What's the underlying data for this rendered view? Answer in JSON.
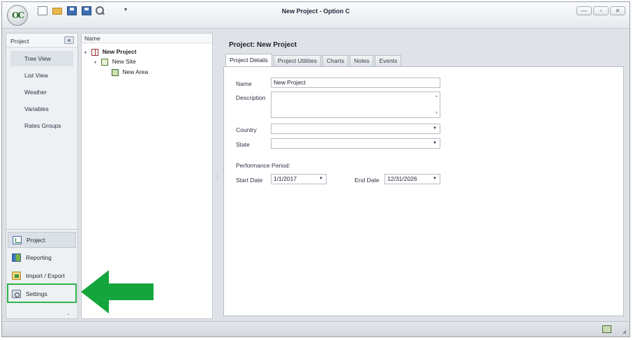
{
  "window": {
    "title": "New Project - Option C",
    "logo_text": "OC",
    "quick_access_more": "▾",
    "buttons": {
      "minimize": "—",
      "restore": "▫",
      "close": "✕"
    }
  },
  "nav": {
    "header": "Project",
    "collapse": "«",
    "items": [
      {
        "label": "Tree View",
        "active": true
      },
      {
        "label": "List View"
      },
      {
        "label": "Weather"
      },
      {
        "label": "Variables"
      },
      {
        "label": "Rates Groups"
      }
    ],
    "groups": [
      {
        "label": "Project",
        "icon": "project-icon",
        "active": true
      },
      {
        "label": "Reporting",
        "icon": "reporting-icon"
      },
      {
        "label": "Import / Export",
        "icon": "import-export-icon"
      },
      {
        "label": "Settings",
        "icon": "settings-icon"
      }
    ],
    "more_chevron": "⌄"
  },
  "tree": {
    "header": "Name",
    "nodes": [
      {
        "label": "New Project",
        "icon": "project-book-icon",
        "toggle": "▾"
      },
      {
        "label": "New Site",
        "icon": "site-icon",
        "toggle": "▾"
      },
      {
        "label": "New Area",
        "icon": "area-icon"
      }
    ]
  },
  "main": {
    "title": "Project: New Project",
    "tabs": [
      {
        "label": "Project Details",
        "active": true
      },
      {
        "label": "Project Utilities"
      },
      {
        "label": "Charts"
      },
      {
        "label": "Notes"
      },
      {
        "label": "Events"
      }
    ],
    "form": {
      "name_label": "Name",
      "name_value": "New Project",
      "description_label": "Description",
      "description_value": "",
      "country_label": "Country",
      "country_value": "",
      "state_label": "State",
      "state_value": "",
      "performance_label": "Performance Period:",
      "start_label": "Start Date",
      "start_value": "1/1/2017",
      "end_label": "End Date",
      "end_value": "12/31/2026"
    }
  },
  "colors": {
    "highlight_green": "#2db34a",
    "arrow_green": "#14a63c"
  }
}
